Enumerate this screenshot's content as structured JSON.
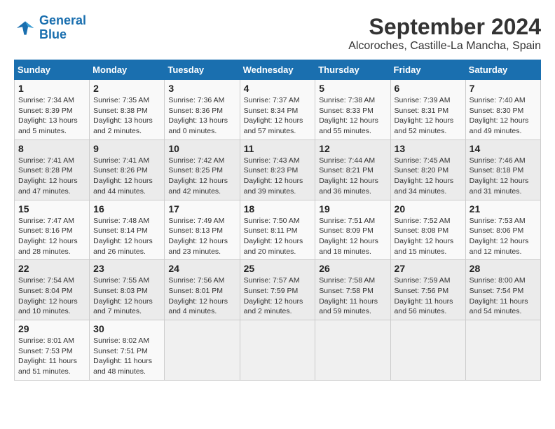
{
  "logo": {
    "line1": "General",
    "line2": "Blue"
  },
  "title": "September 2024",
  "subtitle": "Alcoroches, Castille-La Mancha, Spain",
  "weekdays": [
    "Sunday",
    "Monday",
    "Tuesday",
    "Wednesday",
    "Thursday",
    "Friday",
    "Saturday"
  ],
  "weeks": [
    [
      {
        "day": "1",
        "sunrise": "Sunrise: 7:34 AM",
        "sunset": "Sunset: 8:39 PM",
        "daylight": "Daylight: 13 hours and 5 minutes."
      },
      {
        "day": "2",
        "sunrise": "Sunrise: 7:35 AM",
        "sunset": "Sunset: 8:38 PM",
        "daylight": "Daylight: 13 hours and 2 minutes."
      },
      {
        "day": "3",
        "sunrise": "Sunrise: 7:36 AM",
        "sunset": "Sunset: 8:36 PM",
        "daylight": "Daylight: 13 hours and 0 minutes."
      },
      {
        "day": "4",
        "sunrise": "Sunrise: 7:37 AM",
        "sunset": "Sunset: 8:34 PM",
        "daylight": "Daylight: 12 hours and 57 minutes."
      },
      {
        "day": "5",
        "sunrise": "Sunrise: 7:38 AM",
        "sunset": "Sunset: 8:33 PM",
        "daylight": "Daylight: 12 hours and 55 minutes."
      },
      {
        "day": "6",
        "sunrise": "Sunrise: 7:39 AM",
        "sunset": "Sunset: 8:31 PM",
        "daylight": "Daylight: 12 hours and 52 minutes."
      },
      {
        "day": "7",
        "sunrise": "Sunrise: 7:40 AM",
        "sunset": "Sunset: 8:30 PM",
        "daylight": "Daylight: 12 hours and 49 minutes."
      }
    ],
    [
      {
        "day": "8",
        "sunrise": "Sunrise: 7:41 AM",
        "sunset": "Sunset: 8:28 PM",
        "daylight": "Daylight: 12 hours and 47 minutes."
      },
      {
        "day": "9",
        "sunrise": "Sunrise: 7:41 AM",
        "sunset": "Sunset: 8:26 PM",
        "daylight": "Daylight: 12 hours and 44 minutes."
      },
      {
        "day": "10",
        "sunrise": "Sunrise: 7:42 AM",
        "sunset": "Sunset: 8:25 PM",
        "daylight": "Daylight: 12 hours and 42 minutes."
      },
      {
        "day": "11",
        "sunrise": "Sunrise: 7:43 AM",
        "sunset": "Sunset: 8:23 PM",
        "daylight": "Daylight: 12 hours and 39 minutes."
      },
      {
        "day": "12",
        "sunrise": "Sunrise: 7:44 AM",
        "sunset": "Sunset: 8:21 PM",
        "daylight": "Daylight: 12 hours and 36 minutes."
      },
      {
        "day": "13",
        "sunrise": "Sunrise: 7:45 AM",
        "sunset": "Sunset: 8:20 PM",
        "daylight": "Daylight: 12 hours and 34 minutes."
      },
      {
        "day": "14",
        "sunrise": "Sunrise: 7:46 AM",
        "sunset": "Sunset: 8:18 PM",
        "daylight": "Daylight: 12 hours and 31 minutes."
      }
    ],
    [
      {
        "day": "15",
        "sunrise": "Sunrise: 7:47 AM",
        "sunset": "Sunset: 8:16 PM",
        "daylight": "Daylight: 12 hours and 28 minutes."
      },
      {
        "day": "16",
        "sunrise": "Sunrise: 7:48 AM",
        "sunset": "Sunset: 8:14 PM",
        "daylight": "Daylight: 12 hours and 26 minutes."
      },
      {
        "day": "17",
        "sunrise": "Sunrise: 7:49 AM",
        "sunset": "Sunset: 8:13 PM",
        "daylight": "Daylight: 12 hours and 23 minutes."
      },
      {
        "day": "18",
        "sunrise": "Sunrise: 7:50 AM",
        "sunset": "Sunset: 8:11 PM",
        "daylight": "Daylight: 12 hours and 20 minutes."
      },
      {
        "day": "19",
        "sunrise": "Sunrise: 7:51 AM",
        "sunset": "Sunset: 8:09 PM",
        "daylight": "Daylight: 12 hours and 18 minutes."
      },
      {
        "day": "20",
        "sunrise": "Sunrise: 7:52 AM",
        "sunset": "Sunset: 8:08 PM",
        "daylight": "Daylight: 12 hours and 15 minutes."
      },
      {
        "day": "21",
        "sunrise": "Sunrise: 7:53 AM",
        "sunset": "Sunset: 8:06 PM",
        "daylight": "Daylight: 12 hours and 12 minutes."
      }
    ],
    [
      {
        "day": "22",
        "sunrise": "Sunrise: 7:54 AM",
        "sunset": "Sunset: 8:04 PM",
        "daylight": "Daylight: 12 hours and 10 minutes."
      },
      {
        "day": "23",
        "sunrise": "Sunrise: 7:55 AM",
        "sunset": "Sunset: 8:03 PM",
        "daylight": "Daylight: 12 hours and 7 minutes."
      },
      {
        "day": "24",
        "sunrise": "Sunrise: 7:56 AM",
        "sunset": "Sunset: 8:01 PM",
        "daylight": "Daylight: 12 hours and 4 minutes."
      },
      {
        "day": "25",
        "sunrise": "Sunrise: 7:57 AM",
        "sunset": "Sunset: 7:59 PM",
        "daylight": "Daylight: 12 hours and 2 minutes."
      },
      {
        "day": "26",
        "sunrise": "Sunrise: 7:58 AM",
        "sunset": "Sunset: 7:58 PM",
        "daylight": "Daylight: 11 hours and 59 minutes."
      },
      {
        "day": "27",
        "sunrise": "Sunrise: 7:59 AM",
        "sunset": "Sunset: 7:56 PM",
        "daylight": "Daylight: 11 hours and 56 minutes."
      },
      {
        "day": "28",
        "sunrise": "Sunrise: 8:00 AM",
        "sunset": "Sunset: 7:54 PM",
        "daylight": "Daylight: 11 hours and 54 minutes."
      }
    ],
    [
      {
        "day": "29",
        "sunrise": "Sunrise: 8:01 AM",
        "sunset": "Sunset: 7:53 PM",
        "daylight": "Daylight: 11 hours and 51 minutes."
      },
      {
        "day": "30",
        "sunrise": "Sunrise: 8:02 AM",
        "sunset": "Sunset: 7:51 PM",
        "daylight": "Daylight: 11 hours and 48 minutes."
      },
      null,
      null,
      null,
      null,
      null
    ]
  ]
}
